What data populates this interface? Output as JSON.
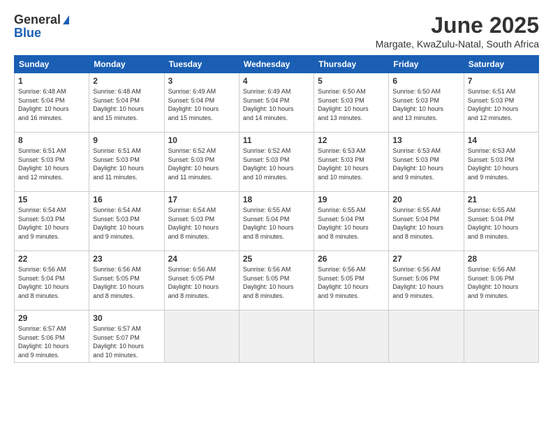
{
  "logo": {
    "general": "General",
    "blue": "Blue"
  },
  "title": "June 2025",
  "location": "Margate, KwaZulu-Natal, South Africa",
  "days_of_week": [
    "Sunday",
    "Monday",
    "Tuesday",
    "Wednesday",
    "Thursday",
    "Friday",
    "Saturday"
  ],
  "weeks": [
    [
      {
        "day": "1",
        "info": "Sunrise: 6:48 AM\nSunset: 5:04 PM\nDaylight: 10 hours\nand 16 minutes."
      },
      {
        "day": "2",
        "info": "Sunrise: 6:48 AM\nSunset: 5:04 PM\nDaylight: 10 hours\nand 15 minutes."
      },
      {
        "day": "3",
        "info": "Sunrise: 6:49 AM\nSunset: 5:04 PM\nDaylight: 10 hours\nand 15 minutes."
      },
      {
        "day": "4",
        "info": "Sunrise: 6:49 AM\nSunset: 5:04 PM\nDaylight: 10 hours\nand 14 minutes."
      },
      {
        "day": "5",
        "info": "Sunrise: 6:50 AM\nSunset: 5:03 PM\nDaylight: 10 hours\nand 13 minutes."
      },
      {
        "day": "6",
        "info": "Sunrise: 6:50 AM\nSunset: 5:03 PM\nDaylight: 10 hours\nand 13 minutes."
      },
      {
        "day": "7",
        "info": "Sunrise: 6:51 AM\nSunset: 5:03 PM\nDaylight: 10 hours\nand 12 minutes."
      }
    ],
    [
      {
        "day": "8",
        "info": "Sunrise: 6:51 AM\nSunset: 5:03 PM\nDaylight: 10 hours\nand 12 minutes."
      },
      {
        "day": "9",
        "info": "Sunrise: 6:51 AM\nSunset: 5:03 PM\nDaylight: 10 hours\nand 11 minutes."
      },
      {
        "day": "10",
        "info": "Sunrise: 6:52 AM\nSunset: 5:03 PM\nDaylight: 10 hours\nand 11 minutes."
      },
      {
        "day": "11",
        "info": "Sunrise: 6:52 AM\nSunset: 5:03 PM\nDaylight: 10 hours\nand 10 minutes."
      },
      {
        "day": "12",
        "info": "Sunrise: 6:53 AM\nSunset: 5:03 PM\nDaylight: 10 hours\nand 10 minutes."
      },
      {
        "day": "13",
        "info": "Sunrise: 6:53 AM\nSunset: 5:03 PM\nDaylight: 10 hours\nand 9 minutes."
      },
      {
        "day": "14",
        "info": "Sunrise: 6:53 AM\nSunset: 5:03 PM\nDaylight: 10 hours\nand 9 minutes."
      }
    ],
    [
      {
        "day": "15",
        "info": "Sunrise: 6:54 AM\nSunset: 5:03 PM\nDaylight: 10 hours\nand 9 minutes."
      },
      {
        "day": "16",
        "info": "Sunrise: 6:54 AM\nSunset: 5:03 PM\nDaylight: 10 hours\nand 9 minutes."
      },
      {
        "day": "17",
        "info": "Sunrise: 6:54 AM\nSunset: 5:03 PM\nDaylight: 10 hours\nand 8 minutes."
      },
      {
        "day": "18",
        "info": "Sunrise: 6:55 AM\nSunset: 5:04 PM\nDaylight: 10 hours\nand 8 minutes."
      },
      {
        "day": "19",
        "info": "Sunrise: 6:55 AM\nSunset: 5:04 PM\nDaylight: 10 hours\nand 8 minutes."
      },
      {
        "day": "20",
        "info": "Sunrise: 6:55 AM\nSunset: 5:04 PM\nDaylight: 10 hours\nand 8 minutes."
      },
      {
        "day": "21",
        "info": "Sunrise: 6:55 AM\nSunset: 5:04 PM\nDaylight: 10 hours\nand 8 minutes."
      }
    ],
    [
      {
        "day": "22",
        "info": "Sunrise: 6:56 AM\nSunset: 5:04 PM\nDaylight: 10 hours\nand 8 minutes."
      },
      {
        "day": "23",
        "info": "Sunrise: 6:56 AM\nSunset: 5:05 PM\nDaylight: 10 hours\nand 8 minutes."
      },
      {
        "day": "24",
        "info": "Sunrise: 6:56 AM\nSunset: 5:05 PM\nDaylight: 10 hours\nand 8 minutes."
      },
      {
        "day": "25",
        "info": "Sunrise: 6:56 AM\nSunset: 5:05 PM\nDaylight: 10 hours\nand 8 minutes."
      },
      {
        "day": "26",
        "info": "Sunrise: 6:56 AM\nSunset: 5:05 PM\nDaylight: 10 hours\nand 9 minutes."
      },
      {
        "day": "27",
        "info": "Sunrise: 6:56 AM\nSunset: 5:06 PM\nDaylight: 10 hours\nand 9 minutes."
      },
      {
        "day": "28",
        "info": "Sunrise: 6:56 AM\nSunset: 5:06 PM\nDaylight: 10 hours\nand 9 minutes."
      }
    ],
    [
      {
        "day": "29",
        "info": "Sunrise: 6:57 AM\nSunset: 5:06 PM\nDaylight: 10 hours\nand 9 minutes."
      },
      {
        "day": "30",
        "info": "Sunrise: 6:57 AM\nSunset: 5:07 PM\nDaylight: 10 hours\nand 10 minutes."
      },
      {
        "day": "",
        "info": ""
      },
      {
        "day": "",
        "info": ""
      },
      {
        "day": "",
        "info": ""
      },
      {
        "day": "",
        "info": ""
      },
      {
        "day": "",
        "info": ""
      }
    ]
  ]
}
